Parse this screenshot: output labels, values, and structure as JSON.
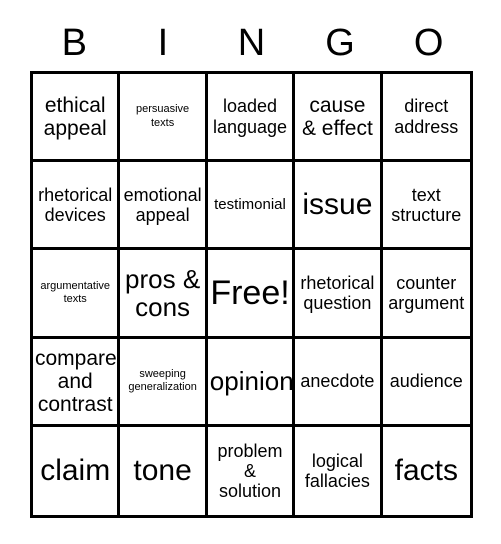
{
  "card": {
    "type": "bingo-card",
    "topic": "persuasive and argumentative text terms",
    "columns": 5,
    "rows": 5,
    "colors": {
      "background": "#ffffff",
      "border": "#000000",
      "text": "#000000"
    }
  },
  "header": {
    "letters": [
      {
        "label": "B"
      },
      {
        "label": "I"
      },
      {
        "label": "N"
      },
      {
        "label": "G"
      },
      {
        "label": "O"
      }
    ]
  },
  "grid": {
    "cells": [
      {
        "label": "ethical\nappeal",
        "size": "lg",
        "free": false
      },
      {
        "label": "persuasive\ntexts",
        "size": "xs",
        "free": false
      },
      {
        "label": "loaded\nlanguage",
        "size": "md",
        "free": false
      },
      {
        "label": "cause\n& effect",
        "size": "lg",
        "free": false
      },
      {
        "label": "direct\naddress",
        "size": "md",
        "free": false
      },
      {
        "label": "rhetorical\ndevices",
        "size": "md",
        "free": false
      },
      {
        "label": "emotional\nappeal",
        "size": "md",
        "free": false
      },
      {
        "label": "testimonial",
        "size": "sm",
        "free": false
      },
      {
        "label": "issue",
        "size": "xxl",
        "free": false
      },
      {
        "label": "text\nstructure",
        "size": "md",
        "free": false
      },
      {
        "label": "argumentative\ntexts",
        "size": "xs",
        "free": false
      },
      {
        "label": "pros &\ncons",
        "size": "xl",
        "free": false
      },
      {
        "label": "Free!",
        "size": "free",
        "free": true
      },
      {
        "label": "rhetorical\nquestion",
        "size": "md",
        "free": false
      },
      {
        "label": "counter\nargument",
        "size": "md",
        "free": false
      },
      {
        "label": "compare\nand\ncontrast",
        "size": "lg",
        "free": false
      },
      {
        "label": "sweeping\ngeneralization",
        "size": "xs",
        "free": false
      },
      {
        "label": "opinion",
        "size": "xl",
        "free": false
      },
      {
        "label": "anecdote",
        "size": "md",
        "free": false
      },
      {
        "label": "audience",
        "size": "md",
        "free": false
      },
      {
        "label": "claim",
        "size": "xxl",
        "free": false
      },
      {
        "label": "tone",
        "size": "xxl",
        "free": false
      },
      {
        "label": "problem\n&\nsolution",
        "size": "md",
        "free": false
      },
      {
        "label": "logical\nfallacies",
        "size": "md",
        "free": false
      },
      {
        "label": "facts",
        "size": "xxl",
        "free": false
      }
    ]
  }
}
